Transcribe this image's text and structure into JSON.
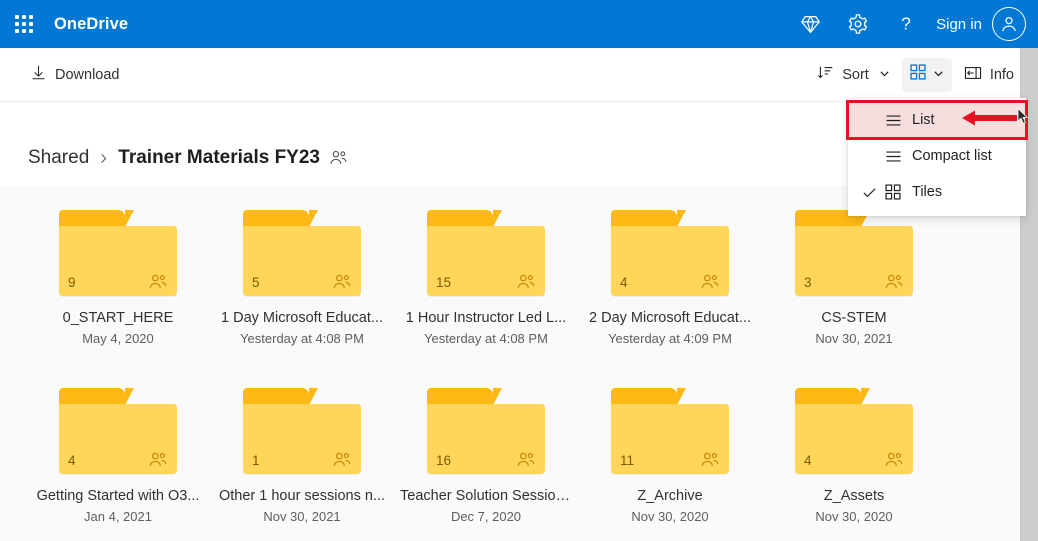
{
  "header": {
    "brand": "OneDrive",
    "waffle_icon": "app-launcher-icon",
    "diamond_icon": "premium-diamond-icon",
    "gear_icon": "settings-gear-icon",
    "help_icon": "help-question-icon",
    "signin_label": "Sign in",
    "avatar_icon": "user-avatar-icon",
    "background_color": "#0078d4"
  },
  "command_bar": {
    "download_label": "Download",
    "download_icon": "download-arrow-icon",
    "sort_label": "Sort",
    "sort_icon": "sort-descending-icon",
    "sort_chevron_icon": "chevron-down-icon",
    "view_icon": "tiles-grid-icon",
    "view_chevron_icon": "chevron-down-icon",
    "info_label": "Info",
    "info_icon": "info-panel-icon"
  },
  "view_menu": {
    "items": [
      {
        "label": "List",
        "icon": "list-lines-icon",
        "checked": false,
        "highlighted": true
      },
      {
        "label": "Compact list",
        "icon": "list-lines-icon",
        "checked": false,
        "highlighted": false
      },
      {
        "label": "Tiles",
        "icon": "tiles-grid-icon",
        "checked": true,
        "highlighted": false
      }
    ],
    "highlight_color": "#e81123",
    "annotation_arrow": "red-left-arrow"
  },
  "breadcrumb": {
    "root": "Shared",
    "separator_icon": "chevron-right-icon",
    "current": "Trainer Materials FY23",
    "shared_icon": "people-shared-icon"
  },
  "folders": [
    {
      "name": "0_START_HERE",
      "date": "May 4, 2020",
      "count": "9"
    },
    {
      "name": "1 Day Microsoft Educat...",
      "date": "Yesterday at 4:08 PM",
      "count": "5"
    },
    {
      "name": "1 Hour Instructor Led L...",
      "date": "Yesterday at 4:08 PM",
      "count": "15"
    },
    {
      "name": "2 Day Microsoft Educat...",
      "date": "Yesterday at 4:09 PM",
      "count": "4"
    },
    {
      "name": "CS-STEM",
      "date": "Nov 30, 2021",
      "count": "3"
    },
    {
      "name": "Getting Started with O3...",
      "date": "Jan 4, 2021",
      "count": "4"
    },
    {
      "name": "Other 1 hour sessions n...",
      "date": "Nov 30, 2021",
      "count": "1"
    },
    {
      "name": "Teacher Solution Session...",
      "date": "Dec 7, 2020",
      "count": "16"
    },
    {
      "name": "Z_Archive",
      "date": "Nov 30, 2020",
      "count": "11"
    },
    {
      "name": "Z_Assets",
      "date": "Nov 30, 2020",
      "count": "4"
    }
  ],
  "colors": {
    "brand_blue": "#0078d4",
    "folder_tab": "#fdb913",
    "folder_body": "#ffd659",
    "accent_red": "#e81123",
    "content_bg": "#fafafa"
  }
}
